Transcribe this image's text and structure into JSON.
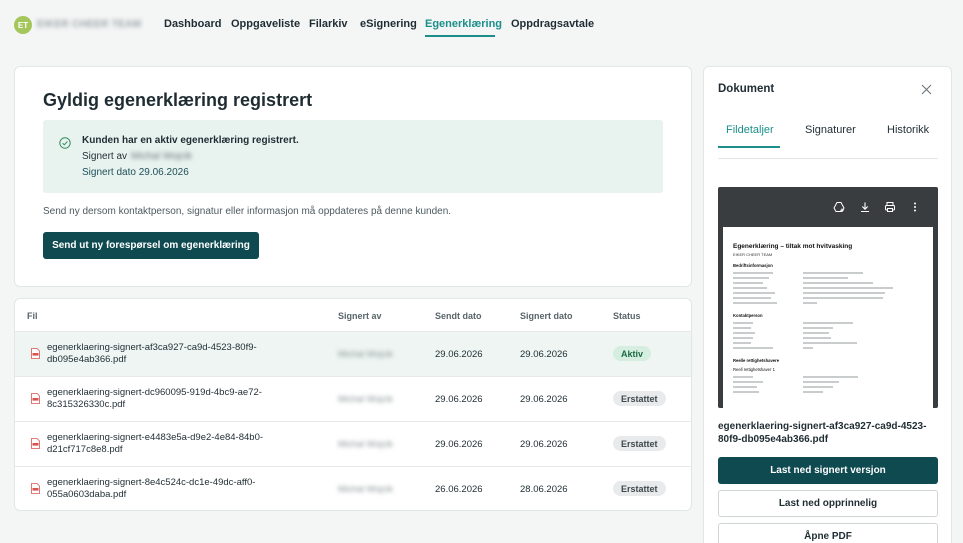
{
  "nav": {
    "avatar_initials": "ET",
    "company_name": "EIKER CHEER TEAM",
    "items": [
      {
        "label": "Dashboard"
      },
      {
        "label": "Oppgaveliste"
      },
      {
        "label": "Filarkiv"
      },
      {
        "label": "eSignering"
      },
      {
        "label": "Egenerklæring"
      },
      {
        "label": "Oppdragsavtale"
      }
    ],
    "active_item": "Egenerklæring",
    "accent_color": "#1c8f8a"
  },
  "status_card": {
    "title": "Gyldig egenerklæring registrert",
    "info_title": "Kunden har en aktiv egenerklæring registrert.",
    "signed_by_label": "Signert av",
    "signed_by_name": "Michal Wojcik",
    "signed_date_text": "Signert dato 29.06.2026",
    "helper_text": "Send ny dersom kontaktperson, signatur eller informasjon må oppdateres på denne kunden.",
    "send_button": "Send ut ny forespørsel om egenerklæring"
  },
  "table": {
    "headers": {
      "file": "Fil",
      "signed_by": "Signert av",
      "sent_date": "Sendt dato",
      "signed_date": "Signert dato",
      "status": "Status"
    },
    "rows": [
      {
        "file": "egenerklaering-signert-af3ca927-ca9d-4523-80f9-db095e4ab366.pdf",
        "signed_by": "Michal Wojcik",
        "sent": "29.06.2026",
        "signed": "29.06.2026",
        "status": "Aktiv"
      },
      {
        "file": "egenerklaering-signert-dc960095-919d-4bc9-ae72-8c315326330c.pdf",
        "signed_by": "Michal Wojcik",
        "sent": "29.06.2026",
        "signed": "29.06.2026",
        "status": "Erstattet"
      },
      {
        "file": "egenerklaering-signert-e4483e5a-d9e2-4e84-84b0-d21cf717c8e8.pdf",
        "signed_by": "Michal Wojcik",
        "sent": "29.06.2026",
        "signed": "29.06.2026",
        "status": "Erstattet"
      },
      {
        "file": "egenerklaering-signert-8e4c524c-dc1e-49dc-aff0-055a0603daba.pdf",
        "signed_by": "Michal Wojcik",
        "sent": "26.06.2026",
        "signed": "28.06.2026",
        "status": "Erstattet"
      }
    ]
  },
  "doc_panel": {
    "title": "Dokument",
    "tabs": [
      {
        "label": "Fildetaljer"
      },
      {
        "label": "Signaturer"
      },
      {
        "label": "Historikk"
      }
    ],
    "active_tab": "Fildetaljer",
    "preview": {
      "title": "Egenerklæring – tiltak mot hvitvasking",
      "subtitle": "EIKER CHEER TEAM",
      "section1": "Bedriftsinformasjon",
      "section2": "Kontaktperson",
      "section3": "Reelle rettighetshavere",
      "section3_sub": "Reell rettighetshaver 1"
    },
    "file_name": "egenerklaering-signert-af3ca927-ca9d-4523-80f9-db095e4ab366.pdf",
    "download_signed": "Last ned signert versjon",
    "download_original": "Last ned opprinnelig",
    "open_pdf": "Åpne PDF"
  }
}
